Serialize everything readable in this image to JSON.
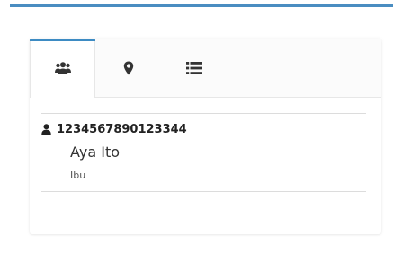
{
  "colors": {
    "accent": "#3d8bc3",
    "icon": "#333333"
  },
  "tabs": [
    {
      "icon": "users-icon",
      "active": true
    },
    {
      "icon": "map-marker-icon",
      "active": false
    },
    {
      "icon": "list-icon",
      "active": false
    }
  ],
  "item": {
    "icon": "user-icon",
    "id": "1234567890123344",
    "name": "Aya Ito",
    "subtitle": "Ibu"
  }
}
